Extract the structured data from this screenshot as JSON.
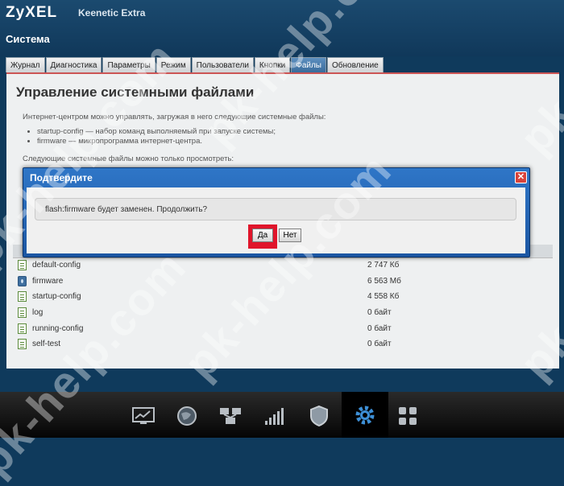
{
  "header": {
    "brand": "ZyXEL",
    "product": "Keenetic Extra",
    "section": "Система"
  },
  "tabs": [
    {
      "label": "Журнал"
    },
    {
      "label": "Диагностика"
    },
    {
      "label": "Параметры"
    },
    {
      "label": "Режим"
    },
    {
      "label": "Пользователи"
    },
    {
      "label": "Кнопки"
    },
    {
      "label": "Файлы",
      "active": true
    },
    {
      "label": "Обновление"
    }
  ],
  "main": {
    "title": "Управление системными файлами",
    "intro": "Интернет-центром можно управлять, загружая в него следующие системные файлы:",
    "bullets": [
      "startup-config — набор команд выполняемый при запуске системы;",
      "firmware — микропрограмма интернет-центра."
    ],
    "view_only": "Следующие системные файлы можно только просмотреть:",
    "files": [
      {
        "name": "default-config",
        "size": "2 747 Кб",
        "icon": "document-icon"
      },
      {
        "name": "firmware",
        "size": "6 563 Мб",
        "icon": "firmware-icon"
      },
      {
        "name": "startup-config",
        "size": "4 558 Кб",
        "icon": "document-icon"
      },
      {
        "name": "log",
        "size": "0 байт",
        "icon": "document-icon"
      },
      {
        "name": "running-config",
        "size": "0 байт",
        "icon": "document-icon"
      },
      {
        "name": "self-test",
        "size": "0 байт",
        "icon": "document-icon"
      }
    ]
  },
  "dialog": {
    "title": "Подтвердите",
    "close": "✕",
    "message": "flash:firmware будет заменен. Продолжить?",
    "yes": "Да",
    "no": "Нет"
  },
  "dock": [
    {
      "icon": "monitor-chart-icon"
    },
    {
      "icon": "globe-icon"
    },
    {
      "icon": "network-icon"
    },
    {
      "icon": "signal-icon"
    },
    {
      "icon": "shield-icon"
    },
    {
      "icon": "gear-icon",
      "active": true
    },
    {
      "icon": "apps-grid-icon"
    }
  ],
  "watermark": "pk-help.com",
  "colors": {
    "accent": "#1b56a3",
    "highlight": "#e0152b",
    "header": "#10385a"
  }
}
